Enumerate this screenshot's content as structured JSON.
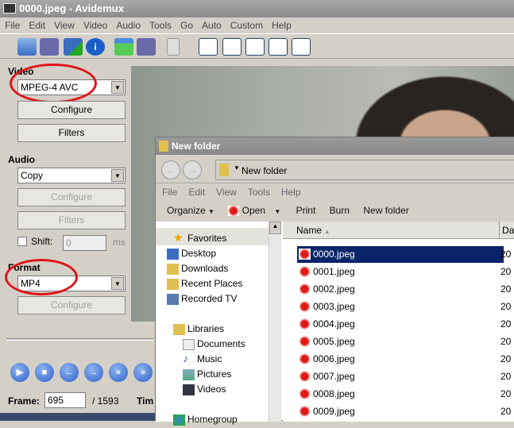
{
  "window": {
    "title": "0000.jpeg - Avidemux"
  },
  "menu": [
    "File",
    "Edit",
    "View",
    "Video",
    "Audio",
    "Tools",
    "Go",
    "Auto",
    "Custom",
    "Help"
  ],
  "video": {
    "label": "Video",
    "codec": "MPEG-4 AVC",
    "configure": "Configure",
    "filters": "Filters"
  },
  "audio": {
    "label": "Audio",
    "codec": "Copy",
    "configure": "Configure",
    "filters": "Filters",
    "shift_label": "Shift:",
    "shift_value": "0",
    "shift_unit": "ms"
  },
  "format": {
    "label": "Format",
    "value": "MP4",
    "configure": "Configure"
  },
  "frame": {
    "label": "Frame:",
    "value": "695",
    "total": "/ 1593",
    "time_label": "Tim"
  },
  "explorer": {
    "title": "New folder",
    "address": "New folder",
    "menu": [
      "File",
      "Edit",
      "View",
      "Tools",
      "Help"
    ],
    "commands": {
      "organize": "Organize",
      "open": "Open",
      "print": "Print",
      "burn": "Burn",
      "new_folder": "New folder"
    },
    "nav": [
      "Favorites",
      "Desktop",
      "Downloads",
      "Recent Places",
      "Recorded TV",
      "Libraries",
      "Documents",
      "Music",
      "Pictures",
      "Videos",
      "Homegroup"
    ],
    "columns": {
      "name": "Name",
      "date": "Da"
    },
    "files": [
      "0000.jpeg",
      "0001.jpeg",
      "0002.jpeg",
      "0003.jpeg",
      "0004.jpeg",
      "0005.jpeg",
      "0006.jpeg",
      "0007.jpeg",
      "0008.jpeg",
      "0009.jpeg"
    ],
    "date_prefix": "20"
  }
}
